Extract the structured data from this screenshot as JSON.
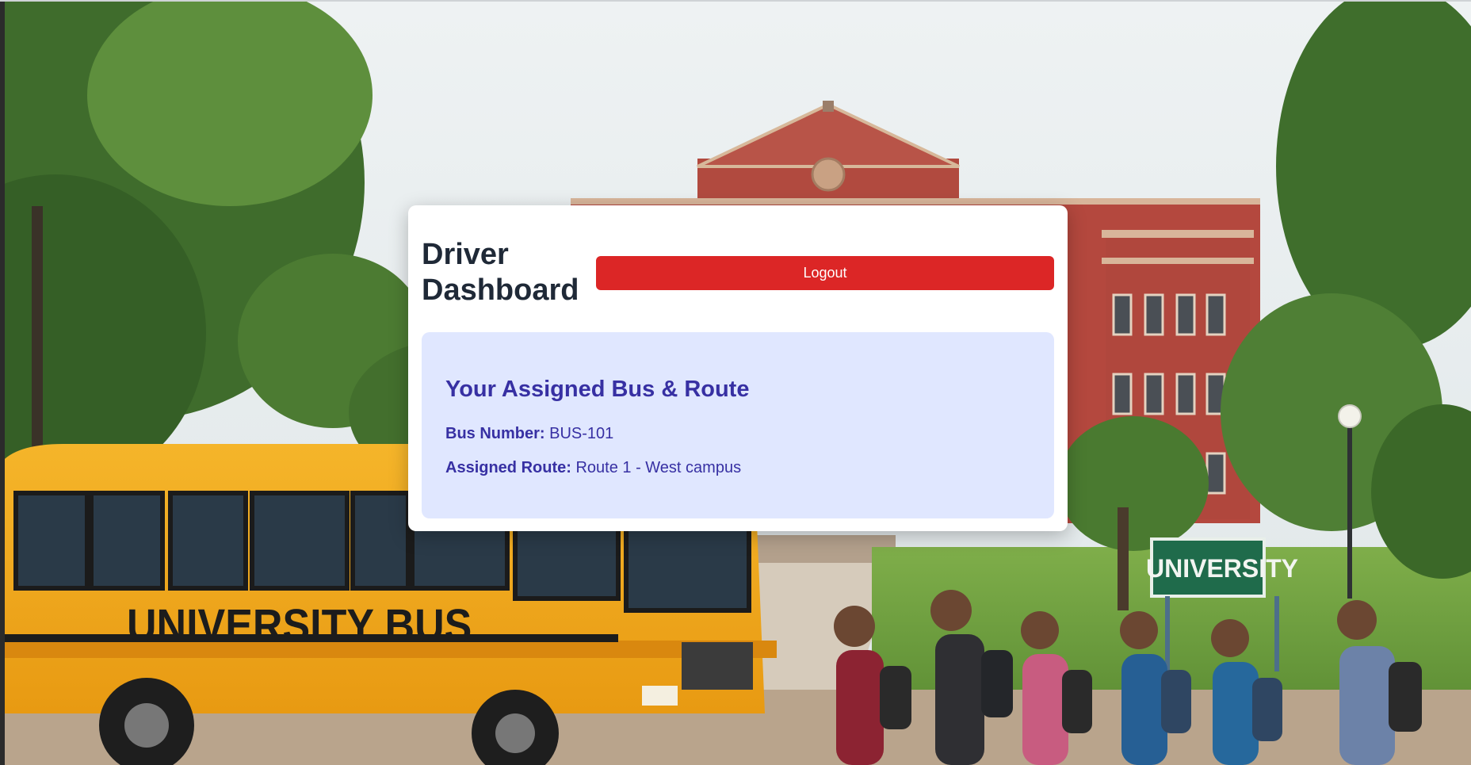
{
  "dashboard": {
    "title": "Driver Dashboard",
    "logout_label": "Logout"
  },
  "assignment": {
    "heading": "Your Assigned Bus & Route",
    "bus_number_label": "Bus Number:",
    "bus_number_value": "BUS-101",
    "route_label": "Assigned Route:",
    "route_value": "Route 1 - West campus"
  },
  "background": {
    "bus_text": "UNIVERSITY BUS",
    "sign_text": "UNIVERSITY"
  },
  "colors": {
    "logout_button": "#dc2626",
    "panel_background": "#e0e7ff",
    "panel_text": "#3730a3",
    "title_text": "#1f2937"
  }
}
